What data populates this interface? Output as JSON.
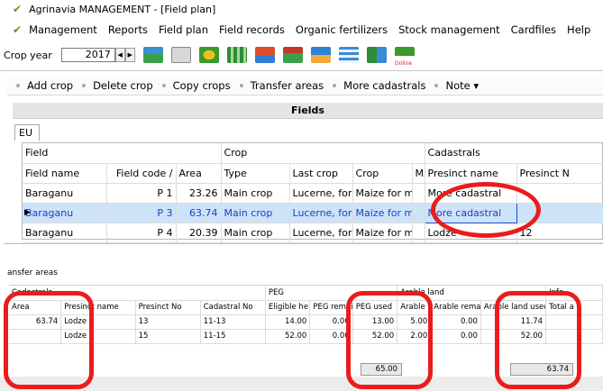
{
  "window": {
    "title": "Agrinavia MANAGEMENT - [Field plan]"
  },
  "menu": [
    "Management",
    "Reports",
    "Field plan",
    "Field records",
    "Organic fertilizers",
    "Stock management",
    "Cardfiles",
    "Help"
  ],
  "toolbar": {
    "crop_year_label": "Crop year",
    "crop_year_value": "2017",
    "online_label": "Online",
    "icons": [
      "field-map-icon",
      "print-icon",
      "crop-icon",
      "grid-icon",
      "tractor-icon",
      "barn-icon",
      "sprayer-icon",
      "table-icon",
      "chart-icon",
      "online-icon"
    ]
  },
  "commands": [
    "Add crop",
    "Delete crop",
    "Copy crops",
    "Transfer areas",
    "More cadastrals",
    "Note ▾"
  ],
  "fields_header": "Fields",
  "tab_label": "EU",
  "grid": {
    "groups": [
      "Field",
      "Crop",
      "Cadastrals"
    ],
    "columns": [
      "Field name",
      "Field code /",
      "Area",
      "Type",
      "Last crop",
      "Crop",
      "M",
      "Presinct name",
      "Presinct N"
    ],
    "rows": [
      [
        "Baraganu",
        "P 1",
        "23.26",
        "Main crop",
        "Lucerne, for fo",
        "Maize for ma",
        "",
        "More cadastral",
        ""
      ],
      [
        "Baraganu",
        "P 3",
        "63.74",
        "Main crop",
        "Lucerne, for fo",
        "Maize for ma",
        "",
        "More cadastral",
        ""
      ],
      [
        "Baraganu",
        "P 4",
        "20.39",
        "Main crop",
        "Lucerne, for fo",
        "Maize for ma",
        "",
        "Lodze",
        "12"
      ]
    ],
    "selected_row": 1
  },
  "lower": {
    "title": "ansfer areas",
    "groups": [
      "Cadastrals",
      "PEG",
      "Arable land",
      "Info"
    ],
    "columns": [
      "Area",
      "Presinct name",
      "Presinct No",
      "Cadastral No",
      "Eligible he",
      "PEG remai",
      "PEG used",
      "Arable land",
      "Arable remai",
      "Arable land used",
      "Total a"
    ],
    "rows": [
      [
        "63.74",
        "Lodze",
        "13",
        "11-13",
        "14.00",
        "0.00",
        "13.00",
        "5.00",
        "0.00",
        "11.74",
        ""
      ],
      [
        "",
        "Lodze",
        "15",
        "11-15",
        "52.00",
        "0.00",
        "52.00",
        "2.00",
        "0.00",
        "52.00",
        ""
      ]
    ],
    "totals": {
      "peg_used": "65.00",
      "arable_land_used": "63.74"
    }
  },
  "colors": {
    "accent": "#ea1c1c",
    "selection": "#cde3f7",
    "link_blue": "#1a3fc9",
    "logo_green": "#5a9a1a"
  }
}
